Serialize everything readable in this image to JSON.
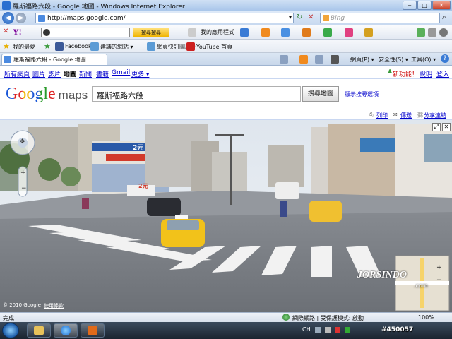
{
  "window": {
    "title": "羅斯福路六段 - Google 地圖 - Windows Internet Explorer"
  },
  "address_bar": {
    "url": "http://maps.google.com/",
    "search_placeholder": "Bing"
  },
  "yahoo_toolbar": {
    "logo": "Y!",
    "search_button": "搜尋搜尋",
    "apps_label": "我的應用程式"
  },
  "favorites_bar": {
    "items": [
      "我的最愛",
      "Facebook",
      "建議的網站 ▾",
      "網頁快訊圖庫 ▾",
      "YouTube 首頁"
    ]
  },
  "tab": {
    "title": "羅斯福路六段 - Google 地圖"
  },
  "command_bar": {
    "page": "網頁(P) ▾",
    "safety": "安全性(S) ▾",
    "tools": "工具(O) ▾"
  },
  "google_bar": {
    "links": [
      "所有網頁",
      "圖片",
      "影片",
      "地圖",
      "新聞",
      "書籍",
      "Gmail",
      "更多 ▾"
    ],
    "right": {
      "new": "新功能！",
      "help": "說明",
      "signin": "登入"
    }
  },
  "maps_header": {
    "logo_google": "Google",
    "logo_maps": "maps",
    "search_value": "羅斯福路六段",
    "search_button": "搜尋地圖",
    "options_link": "顯示搜尋選項"
  },
  "map_toolbar": {
    "print": "列印",
    "send": "傳送",
    "share": "分享連結"
  },
  "street_view": {
    "copyright": "© 2010 Google",
    "terms": "使用條款",
    "signs": [
      "2元",
      "2元"
    ]
  },
  "status_bar": {
    "left": "完成",
    "zone": "網際網路 | 受保護模式: 啟動",
    "zoom": "100%"
  },
  "taskbar": {
    "ime": "CH"
  },
  "watermark": {
    "brand": "JORSINDO",
    "id": "#450057",
    "site": ".com"
  },
  "colors": {
    "link": "#0000cc",
    "sky": "#dfe6ee",
    "road": "#7b7f86",
    "taxi": "#f2c21a"
  }
}
